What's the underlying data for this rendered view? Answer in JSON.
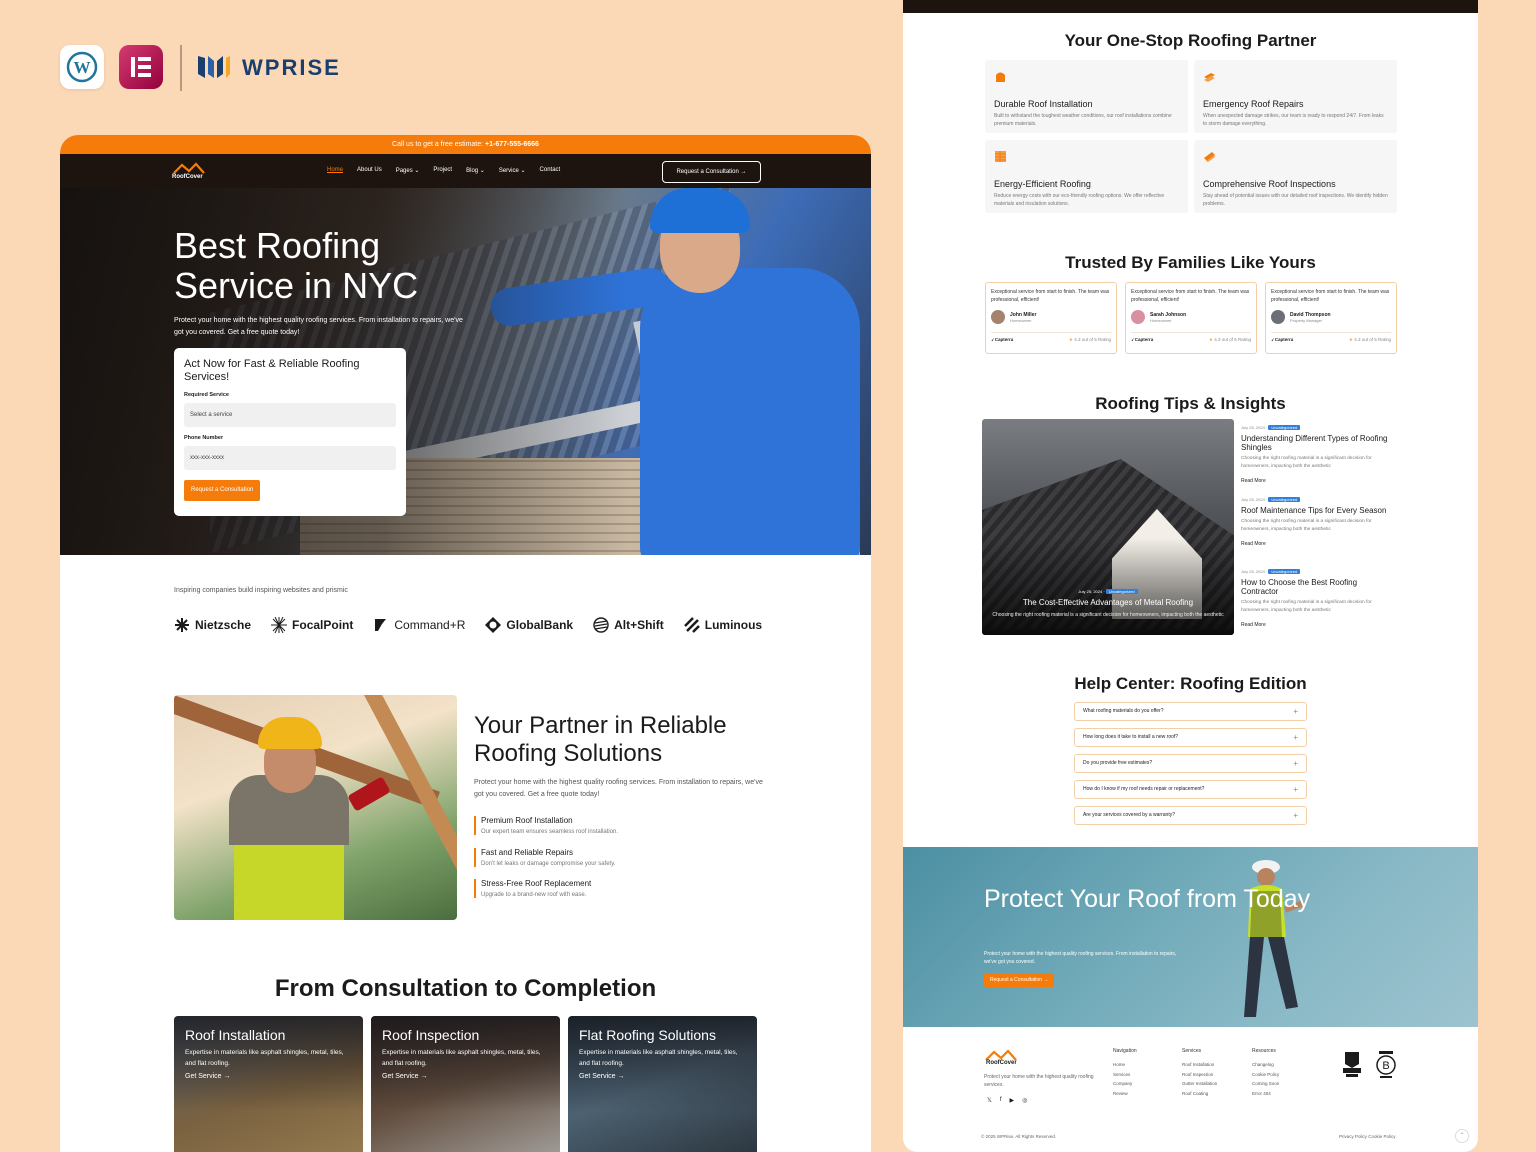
{
  "brand": {
    "wordpress_icon": "wordpress-icon",
    "elementor_icon": "elementor-icon",
    "wprise_name": "WPRISE"
  },
  "colors": {
    "accent": "#f57c0a",
    "dark": "#1d1410",
    "background": "#fcd9b6"
  },
  "left": {
    "topbar": {
      "text": "Call us to get a free estimate:",
      "phone": "+1-677-555-6666"
    },
    "nav": {
      "logo": "RoofCover",
      "links": [
        "Home",
        "About Us",
        "Pages",
        "Project",
        "Blog",
        "Service",
        "Contact"
      ],
      "dropdown_suffix": "⌄",
      "cta": "Request a Consultation"
    },
    "hero": {
      "title": "Best Roofing Service in NYC",
      "subtitle": "Protect your home with the highest quality roofing services. From installation to repairs, we've got you covered. Get a free quote today!",
      "form": {
        "title": "Act Now for Fast & Reliable Roofing Services!",
        "service_label": "Required Service",
        "service_placeholder": "Select a service",
        "phone_label": "Phone Number",
        "phone_placeholder": "xxx-xxx-xxxx",
        "submit": "Request a Consultation"
      }
    },
    "clients": {
      "caption": "Inspiring companies build inspiring websites and prismic",
      "logos": [
        "Nietzsche",
        "FocalPoint",
        "Command+R",
        "GlobalBank",
        "Alt+Shift",
        "Luminous"
      ]
    },
    "partner": {
      "title": "Your Partner in Reliable Roofing Solutions",
      "description": "Protect your home with the highest quality roofing services. From installation to repairs, we've got you covered. Get a free quote today!",
      "features": [
        {
          "title": "Premium Roof Installation",
          "desc": "Our expert team ensures seamless roof installation."
        },
        {
          "title": "Fast and Reliable Repairs",
          "desc": "Don't let leaks or damage compromise your safety."
        },
        {
          "title": "Stress-Free Roof Replacement",
          "desc": "Upgrade to a brand-new roof with ease."
        }
      ]
    },
    "process": {
      "title": "From Consultation to Completion",
      "cards": [
        {
          "title": "Roof Installation",
          "desc": "Expertise in materials like asphalt shingles, metal, tiles, and flat roofing.",
          "link": "Get Service →"
        },
        {
          "title": "Roof Inspection",
          "desc": "Expertise in materials like asphalt shingles, metal, tiles, and flat roofing.",
          "link": "Get Service →"
        },
        {
          "title": "Flat Roofing Solutions",
          "desc": "Expertise in materials like asphalt shingles, metal, tiles, and flat roofing.",
          "link": "Get Service →"
        }
      ]
    }
  },
  "right": {
    "services": {
      "title": "Your One-Stop Roofing Partner",
      "cards": [
        {
          "title": "Durable Roof Installation",
          "desc": "Built to withstand the toughest weather conditions, our roof installations combine premium materials."
        },
        {
          "title": "Emergency Roof Repairs",
          "desc": "When unexpected damage strikes, our team is ready to respond 24/7. From leaks to storm damage everything."
        },
        {
          "title": "Energy-Efficient Roofing",
          "desc": "Reduce energy costs with our eco-friendly roofing options. We offer reflective materials and insulation solutions."
        },
        {
          "title": "Comprehensive Roof Inspections",
          "desc": "Stay ahead of potential issues with our detailed roof inspections. We identify hidden problems."
        }
      ]
    },
    "testimonials": {
      "title": "Trusted By Families Like Yours",
      "items": [
        {
          "text": "Exceptional service from start to finish. The team was professional, efficient!",
          "name": "John Miller",
          "role": "Homeowner",
          "source": "Capterra",
          "rating": "4.3 out of 5 Rating"
        },
        {
          "text": "Exceptional service from start to finish. The team was professional, efficient!",
          "name": "Sarah Johnson",
          "role": "Homeowner",
          "source": "Capterra",
          "rating": "4.3 out of 5 Rating"
        },
        {
          "text": "Exceptional service from start to finish. The team was professional, efficient!",
          "name": "David Thompson",
          "role": "Property Manager",
          "source": "Capterra",
          "rating": "4.3 out of 5 Rating"
        }
      ]
    },
    "blog": {
      "title": "Roofing Tips & Insights",
      "featured": {
        "date": "July 25, 2024",
        "category": "Uncategorized",
        "title": "The Cost-Effective Advantages of Metal Roofing",
        "desc": "Choosing the right roofing material is a significant decision for homeowners, impacting both the aesthetic"
      },
      "items": [
        {
          "date": "July 25, 2024",
          "category": "Uncategorized",
          "title": "Understanding Different Types of Roofing Shingles",
          "desc": "Choosing the right roofing material is a significant decision for homeowners, impacting both the aesthetic",
          "more": "Read More"
        },
        {
          "date": "July 25, 2024",
          "category": "Uncategorized",
          "title": "Roof Maintenance Tips for Every Season",
          "desc": "Choosing the right roofing material is a significant decision for homeowners, impacting both the aesthetic",
          "more": "Read More"
        },
        {
          "date": "July 25, 2024",
          "category": "Uncategorized",
          "title": "How to Choose the Best Roofing Contractor",
          "desc": "Choosing the right roofing material is a significant decision for homeowners, impacting both the aesthetic",
          "more": "Read More"
        }
      ]
    },
    "faq": {
      "title": "Help Center: Roofing Edition",
      "items": [
        "What roofing materials do you offer?",
        "How long does it take to install a new roof?",
        "Do you provide free estimates?",
        "How do I know if my roof needs repair or replacement?",
        "Are your services covered by a warranty?"
      ],
      "expand": "+"
    },
    "cta": {
      "title": "Protect Your Roof from Today",
      "subtitle": "Protect your home with the highest quality roofing services. From installation to repairs, we've got you covered.",
      "button": "Request a Consultation →"
    },
    "footer": {
      "logo": "RoofCover",
      "desc": "Protect your home with the highest quality roofing services.",
      "social": [
        "𝕏",
        "f",
        "▶",
        "◎"
      ],
      "columns": [
        {
          "title": "Navigation",
          "links": [
            "Home",
            "Services",
            "Company",
            "Review"
          ]
        },
        {
          "title": "Services",
          "links": [
            "Roof Installation",
            "Roof Inspection",
            "Gutter Installation",
            "Roof Coating"
          ]
        },
        {
          "title": "Resources",
          "links": [
            "Changelog",
            "Cookie Policy",
            "Coming Soon",
            "Error 404"
          ]
        }
      ],
      "copyright": "© 2025 WPRise. All Rights Reserved.",
      "legal": "Privacy Policy  Cookie Policy",
      "to_top": "⌃"
    }
  }
}
